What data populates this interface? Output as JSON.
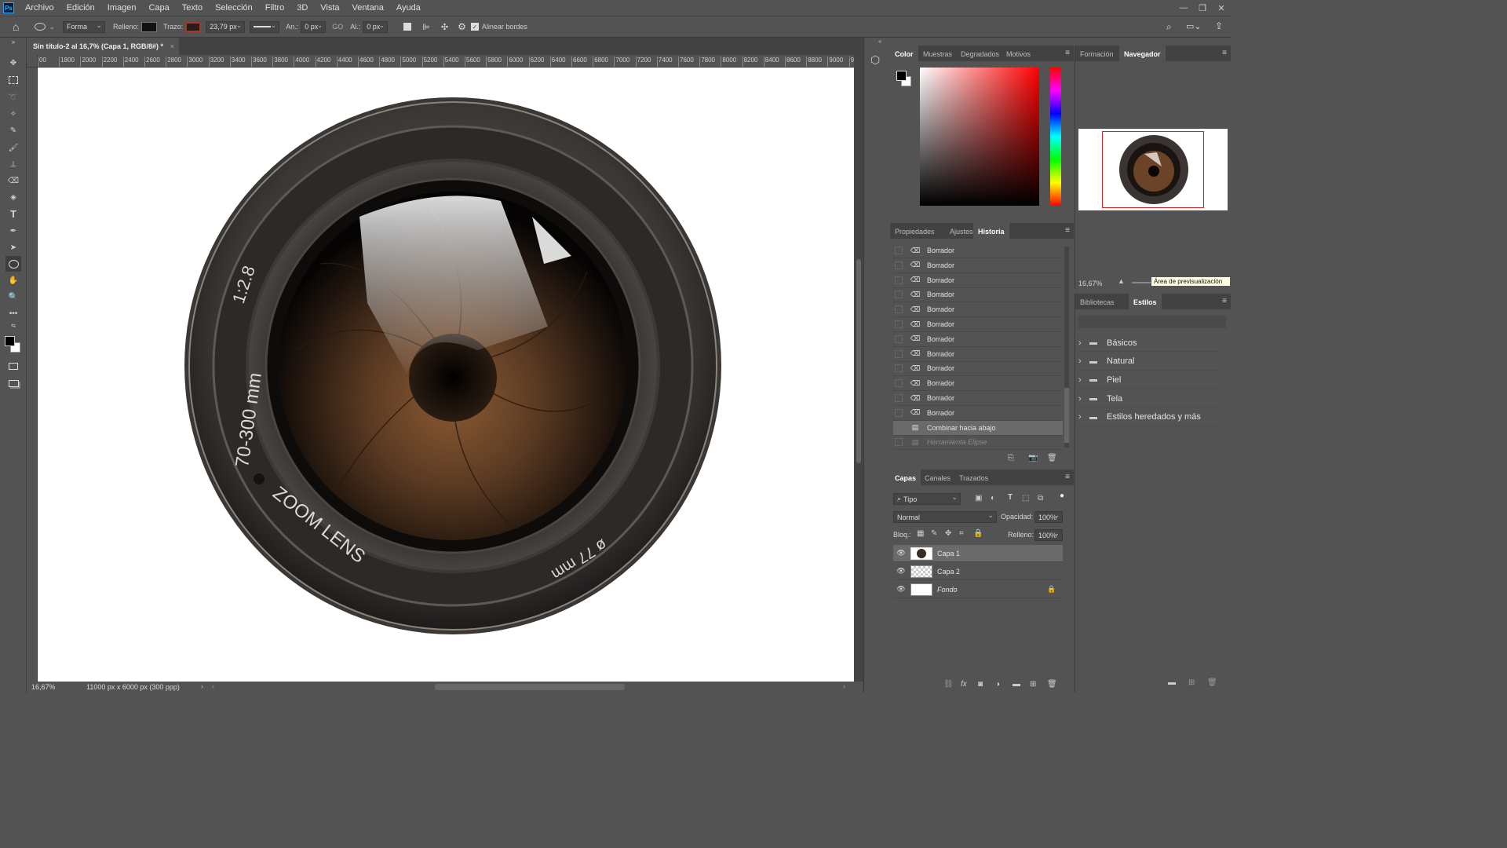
{
  "app_logo": "Ps",
  "menu": [
    "Archivo",
    "Edición",
    "Imagen",
    "Capa",
    "Texto",
    "Selección",
    "Filtro",
    "3D",
    "Vista",
    "Ventana",
    "Ayuda"
  ],
  "options_bar": {
    "mode": "Forma",
    "fill_label": "Relleno:",
    "stroke_label": "Trazo:",
    "stroke_width": "23,79 px",
    "width_label": "An.:",
    "width_value": "0 px",
    "link_label": "GO",
    "height_label": "Al.:",
    "height_value": "0 px",
    "align_edges": "Alinear bordes",
    "fill_color": "#111111",
    "stroke_color": "#7a2a1a"
  },
  "document_tab": "Sin título-2 al 16,7% (Capa 1, RGB/8#) *",
  "ruler_ticks": [
    "00",
    "1800",
    "2000",
    "2200",
    "2400",
    "2600",
    "2800",
    "3000",
    "3200",
    "3400",
    "3600",
    "3800",
    "4000",
    "4200",
    "4400",
    "4600",
    "4800",
    "5000",
    "5200",
    "5400",
    "5600",
    "5800",
    "6000",
    "6200",
    "6400",
    "6600",
    "6800",
    "7000",
    "7200",
    "7400",
    "7600",
    "7800",
    "8000",
    "8200",
    "8400",
    "8600",
    "8800",
    "9000",
    "920"
  ],
  "lens": {
    "aperture": "1:2.8",
    "focal": "70-300 mm",
    "name": "ZOOM LENS",
    "filter": "ø 77 mm"
  },
  "status": {
    "zoom": "16,67%",
    "doc_info": "11000 px x 6000 px (300 ppp)"
  },
  "color_panel": {
    "tabs": [
      "Color",
      "Muestras",
      "Degradados",
      "Motivos"
    ],
    "active": "Color",
    "hue_color": "#ff0000"
  },
  "history_panel": {
    "tabs": [
      "Propiedades",
      "Ajustes",
      "Historia"
    ],
    "active": "Historia",
    "items": [
      {
        "label": "Borrador"
      },
      {
        "label": "Borrador"
      },
      {
        "label": "Borrador"
      },
      {
        "label": "Borrador"
      },
      {
        "label": "Borrador"
      },
      {
        "label": "Borrador"
      },
      {
        "label": "Borrador"
      },
      {
        "label": "Borrador"
      },
      {
        "label": "Borrador"
      },
      {
        "label": "Borrador"
      },
      {
        "label": "Borrador"
      },
      {
        "label": "Borrador"
      },
      {
        "label": "Combinar hacia abajo"
      },
      {
        "label": "Herramienta Elipse"
      }
    ]
  },
  "layers_panel": {
    "tabs": [
      "Capas",
      "Canales",
      "Trazados"
    ],
    "active": "Capas",
    "filter": "Tipo",
    "blend": "Normal",
    "opacity_label": "Opacidad:",
    "opacity": "100%",
    "lock_label": "Bloq.:",
    "fill_label": "Relleno:",
    "fill": "100%",
    "layers": [
      {
        "name": "Capa 1"
      },
      {
        "name": "Capa 2"
      },
      {
        "name": "Fondo"
      }
    ]
  },
  "navigator_panel": {
    "tabs": [
      "Formación",
      "Navegador"
    ],
    "active": "Navegador",
    "zoom": "16,67%",
    "tooltip": "Área de previsualización"
  },
  "styles_panel": {
    "tabs": [
      "Bibliotecas",
      "Estilos"
    ],
    "active": "Estilos",
    "groups": [
      "Básicos",
      "Natural",
      "Piel",
      "Tela",
      "Estilos heredados y más"
    ]
  }
}
